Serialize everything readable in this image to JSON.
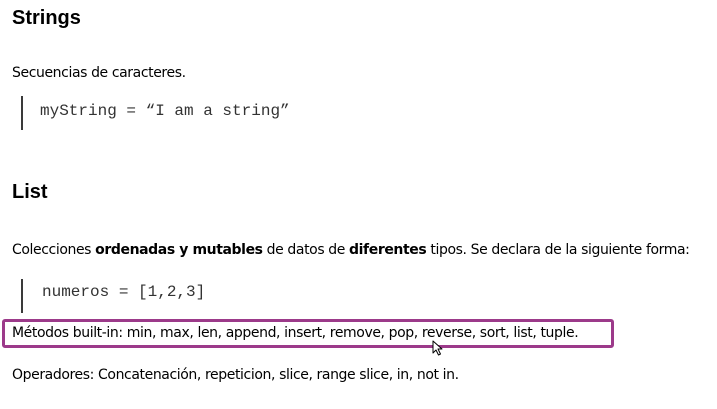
{
  "strings": {
    "heading": "Strings",
    "description": "Secuencias de caracteres.",
    "code": "myString = “I am a string”"
  },
  "list": {
    "heading": "List",
    "description": {
      "t1": "Colecciones ",
      "b1": "ordenadas y mutables",
      "t2": " de datos de ",
      "b2": "diferentes",
      "t3": " tipos. Se declara de la siguiente forma:"
    },
    "code": "numeros = [1,2,3]",
    "methods": "Métodos built-in: min, max, len, append, insert, remove, pop, reverse, sort, list, tuple.",
    "operators": "Operadores: Concatenación, repeticion, slice, range slice, in, not in."
  },
  "colors": {
    "highlight_box": "#9c3a8a"
  },
  "icons": {
    "cursor": "mouse-pointer-icon"
  }
}
